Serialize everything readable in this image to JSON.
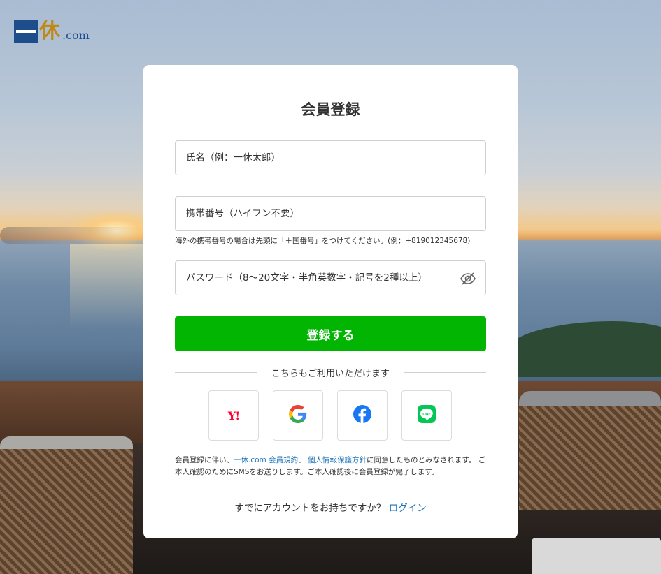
{
  "logo": {
    "kanji": "休",
    "suffix": ".com",
    "brand_color": "#1e4d8c",
    "kanji_color": "#c08a1a"
  },
  "form": {
    "title": "会員登録",
    "name_placeholder": "氏名（例：一休太郎）",
    "name_value": "",
    "phone_placeholder": "携帯番号（ハイフン不要）",
    "phone_value": "",
    "phone_hint": "海外の携帯番号の場合は先頭に「＋国番号」をつけてください。(例：+819012345678)",
    "password_placeholder": "パスワード（8〜20文字・半角英数字・記号を2種以上）",
    "password_value": "",
    "password_toggle_icon": "eye-off-icon",
    "submit_label": "登録する",
    "submit_color": "#02b502"
  },
  "social": {
    "divider_text": "こちらもご利用いただけます",
    "providers": [
      {
        "name": "Yahoo! JAPAN",
        "icon": "yahoo-icon",
        "label": "Y!"
      },
      {
        "name": "Google",
        "icon": "google-icon"
      },
      {
        "name": "Facebook",
        "icon": "facebook-icon"
      },
      {
        "name": "LINE",
        "icon": "line-icon",
        "label": "LINE"
      }
    ]
  },
  "terms": {
    "prefix": "会員登録に伴い、",
    "link1": "一休.com 会員規約",
    "sep": "、 ",
    "link2": "個人情報保護方針",
    "suffix": "に同意したものとみなされます。 ご本人確認のためにSMSをお送りします。ご本人確認後に会員登録が完了します。",
    "link_color": "#1a73b8"
  },
  "login": {
    "question": "すでにアカウントをお持ちですか？ ",
    "link": "ログイン"
  }
}
